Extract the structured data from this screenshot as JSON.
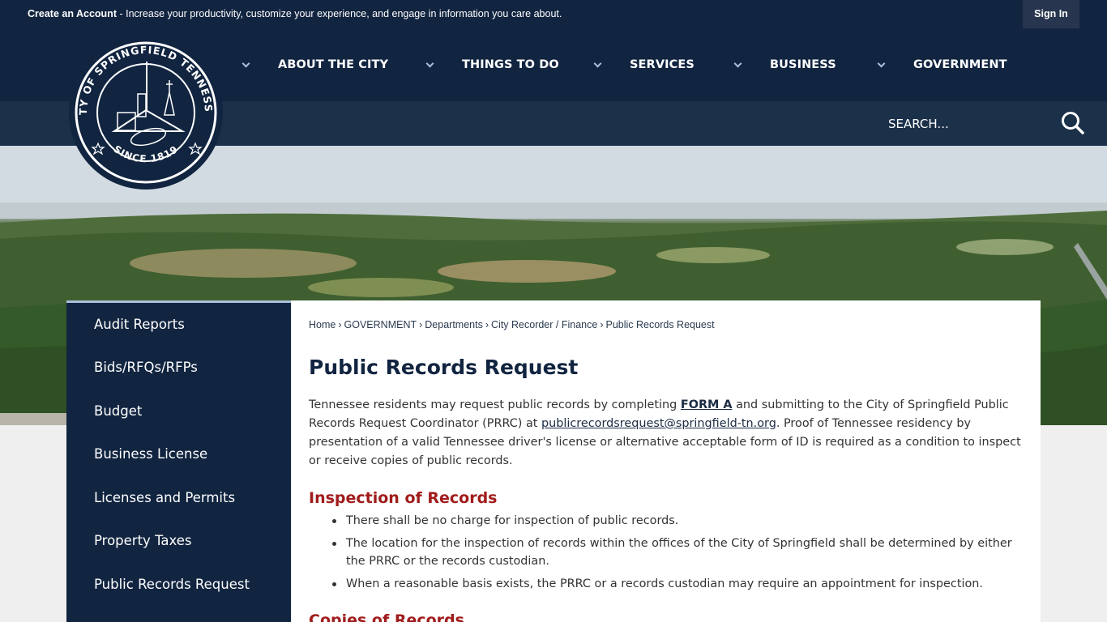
{
  "topbar": {
    "create_account": "Create an Account",
    "create_account_rest": " - Increase your productivity, customize your experience, and engage in information you care about.",
    "sign_in": "Sign In"
  },
  "logo": {
    "ring_text": "CITY OF SPRINGFIELD TENNESSEE",
    "since": "SINCE 1819"
  },
  "nav": {
    "items": [
      {
        "label": "ABOUT THE CITY"
      },
      {
        "label": "THINGS TO DO"
      },
      {
        "label": "SERVICES"
      },
      {
        "label": "BUSINESS"
      },
      {
        "label": "GOVERNMENT"
      }
    ]
  },
  "search": {
    "placeholder": "SEARCH..."
  },
  "sidebar": {
    "items": [
      {
        "label": "Audit Reports"
      },
      {
        "label": "Bids/RFQs/RFPs"
      },
      {
        "label": "Budget"
      },
      {
        "label": "Business License"
      },
      {
        "label": "Licenses and Permits"
      },
      {
        "label": "Property Taxes"
      },
      {
        "label": "Public Records Request"
      }
    ]
  },
  "breadcrumb": {
    "items": [
      "Home",
      "GOVERNMENT",
      "Departments",
      "City Recorder / Finance",
      "Public Records Request"
    ],
    "separator": "›"
  },
  "main": {
    "title": "Public Records Request",
    "intro_1": "Tennessee residents may request public records by completing ",
    "form_link": "FORM A",
    "intro_2": " and submitting to the City of Springfield Public Records Request Coordinator (PRRC) at ",
    "email_link": "publicrecordsrequest@springfield-tn.org",
    "intro_3": ".  Proof of Tennessee residency by presentation of a valid Tennessee driver's license or alternative acceptable form of ID is required as a condition to inspect or receive copies of public records.",
    "section1_title": "Inspection of Records",
    "section1_items": [
      "There shall be no charge for inspection of public records.",
      "The location for the inspection of records within the offices of the City of Springfield shall be determined by either the PRRC or the records custodian.",
      "When a reasonable basis exists, the PRRC or a records custodian may require an appointment for inspection."
    ],
    "section2_title": "Copies of Records"
  },
  "colors": {
    "navy": "#112440",
    "search_bar": "#1b3049",
    "accent_red": "#a11c1c",
    "chevron": "#a9c1dc"
  }
}
